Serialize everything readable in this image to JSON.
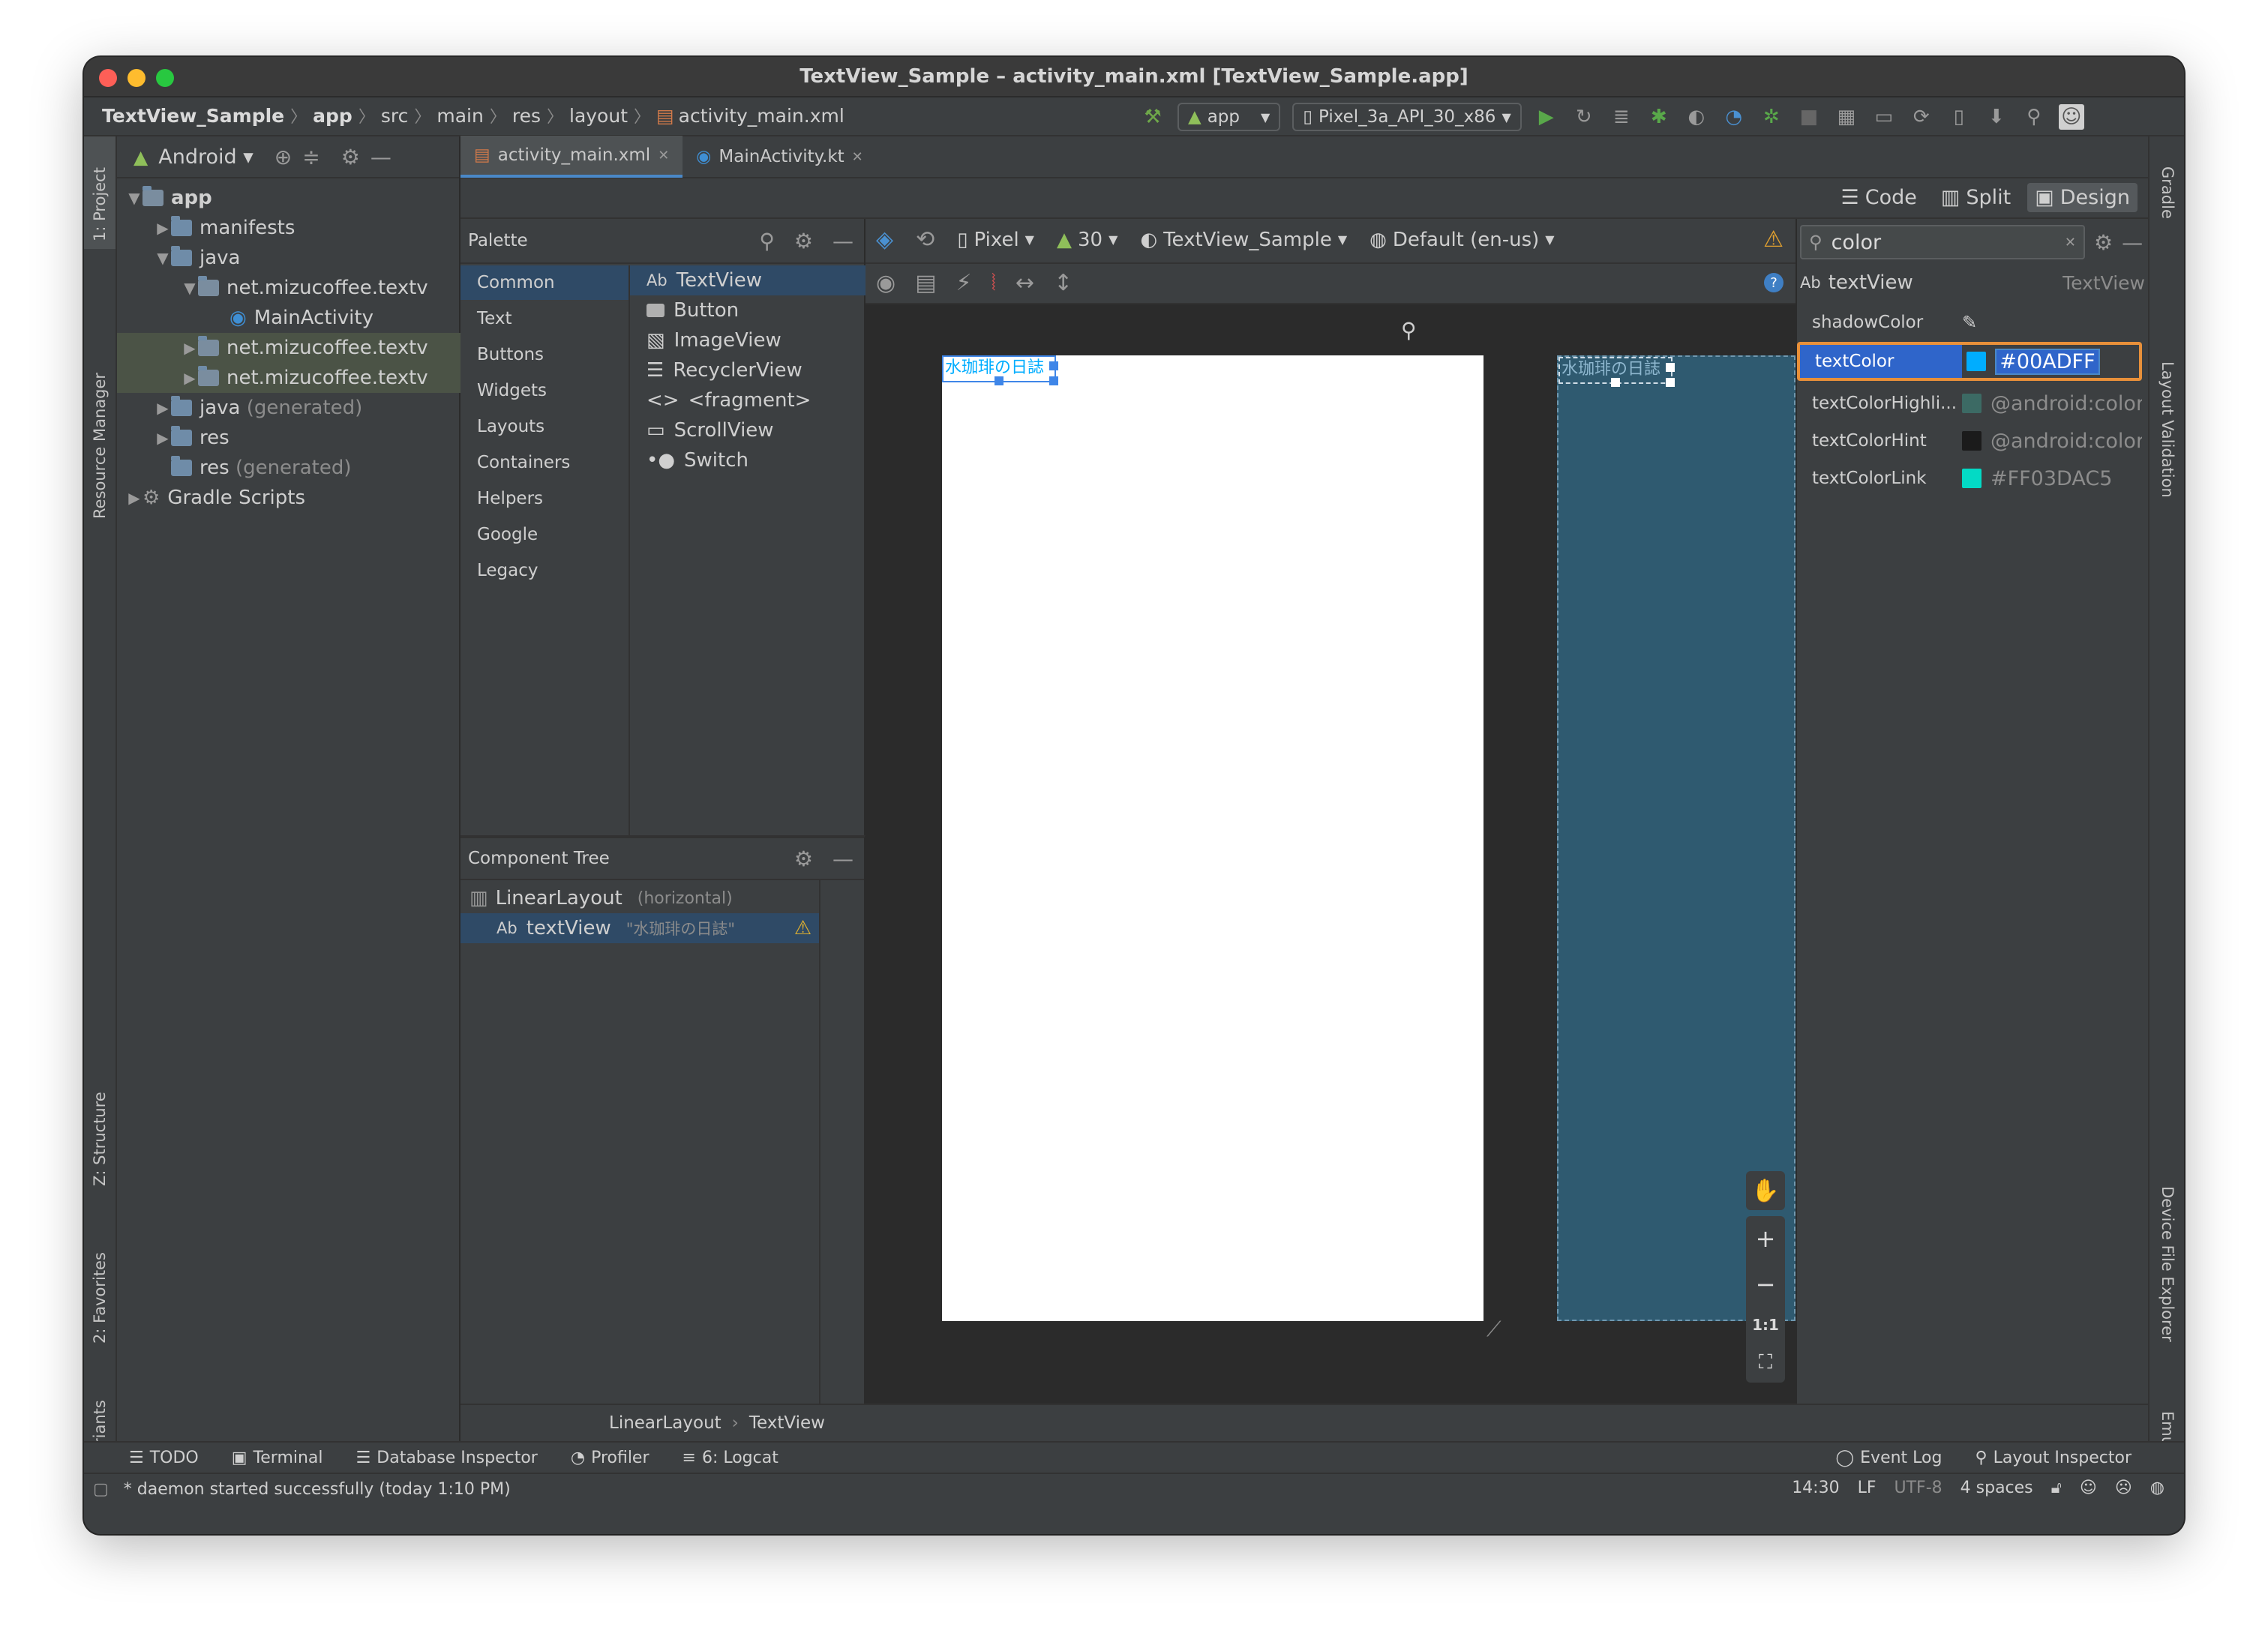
{
  "window": {
    "title": "TextView_Sample – activity_main.xml [TextView_Sample.app]"
  },
  "breadcrumbs": [
    "TextView_Sample",
    "app",
    "src",
    "main",
    "res",
    "layout",
    "activity_main.xml"
  ],
  "toolbar": {
    "run_config": "app",
    "device": "Pixel_3a_API_30_x86"
  },
  "left_strip": {
    "project_tab": "1: Project",
    "resource_manager_tab": "Resource Manager",
    "structure_tab": "Z: Structure",
    "favorites_tab": "2: Favorites",
    "build_variants_tab": "Build Variants"
  },
  "right_strip": {
    "gradle_tab": "Gradle",
    "layout_validation_tab": "Layout Validation",
    "device_file_explorer_tab": "Device File Explorer",
    "emulator_tab": "Emulator"
  },
  "project": {
    "view_mode": "Android",
    "tree": [
      {
        "label": "app",
        "suffix": ""
      },
      {
        "label": "manifests",
        "suffix": ""
      },
      {
        "label": "java",
        "suffix": ""
      },
      {
        "label": "net.mizucoffee.textv",
        "suffix": ""
      },
      {
        "label": "MainActivity",
        "suffix": ""
      },
      {
        "label": "net.mizucoffee.textv",
        "suffix": ""
      },
      {
        "label": "net.mizucoffee.textv",
        "suffix": ""
      },
      {
        "label": "java",
        "suffix": "(generated)"
      },
      {
        "label": "res",
        "suffix": ""
      },
      {
        "label": "res",
        "suffix": "(generated)"
      },
      {
        "label": "Gradle Scripts",
        "suffix": ""
      }
    ]
  },
  "editor_tabs": [
    {
      "label": "activity_main.xml"
    },
    {
      "label": "MainActivity.kt"
    }
  ],
  "view_modes": {
    "code": "Code",
    "split": "Split",
    "design": "Design"
  },
  "palette": {
    "title": "Palette",
    "categories": [
      "Common",
      "Text",
      "Buttons",
      "Widgets",
      "Layouts",
      "Containers",
      "Helpers",
      "Google",
      "Legacy"
    ],
    "items": [
      {
        "prefix": "Ab",
        "label": "TextView"
      },
      {
        "prefix": "",
        "label": "Button"
      },
      {
        "prefix": "",
        "label": "ImageView"
      },
      {
        "prefix": "",
        "label": "RecyclerView"
      },
      {
        "prefix": "<>",
        "label": "<fragment>"
      },
      {
        "prefix": "",
        "label": "ScrollView"
      },
      {
        "prefix": "",
        "label": "Switch"
      }
    ]
  },
  "component_tree": {
    "title": "Component Tree",
    "root": {
      "label": "LinearLayout",
      "meta": "(horizontal)"
    },
    "child": {
      "prefix": "Ab",
      "label": "textView",
      "meta": "\"水珈琲の日誌\""
    }
  },
  "design_toolbar": {
    "device": "Pixel",
    "api": "30",
    "theme": "TextView_Sample",
    "locale": "Default (en-us)"
  },
  "canvas": {
    "design_text": "水珈琲の日誌",
    "blueprint_text": "水珈琲の日誌",
    "zoom_fit": "1:1"
  },
  "attributes": {
    "search": "color",
    "component_prefix": "Ab",
    "component_name": "textView",
    "component_type": "TextView",
    "rows": [
      {
        "name": "shadowColor",
        "value": "",
        "swatch": ""
      },
      {
        "name": "textColor",
        "value": "#00ADFF",
        "swatch": "#00ADFF"
      },
      {
        "name": "textColorHighli...",
        "value": "@android:color/hig",
        "swatch": "#3c6a64"
      },
      {
        "name": "textColorHint",
        "value": "@android:color/hin",
        "swatch": "#1b1b1b"
      },
      {
        "name": "textColorLink",
        "value": "#FF03DAC5",
        "swatch": "#03DAC5"
      }
    ]
  },
  "editor_breadcrumb": [
    "LinearLayout",
    "TextView"
  ],
  "bottom_tools": {
    "todo": "TODO",
    "terminal": "Terminal",
    "database_inspector": "Database Inspector",
    "profiler": "Profiler",
    "logcat": "6: Logcat",
    "event_log": "Event Log",
    "layout_inspector": "Layout Inspector"
  },
  "status": {
    "message": "* daemon started successfully (today 1:10 PM)",
    "position": "14:30",
    "line_sep": "LF",
    "encoding": "UTF-8",
    "indent": "4 spaces"
  },
  "colors": {
    "selection_blue": "#2f65ca",
    "focus_orange": "#e8903a",
    "text_color_value": "#00ADFF",
    "blueprint": "#2f5a70"
  }
}
